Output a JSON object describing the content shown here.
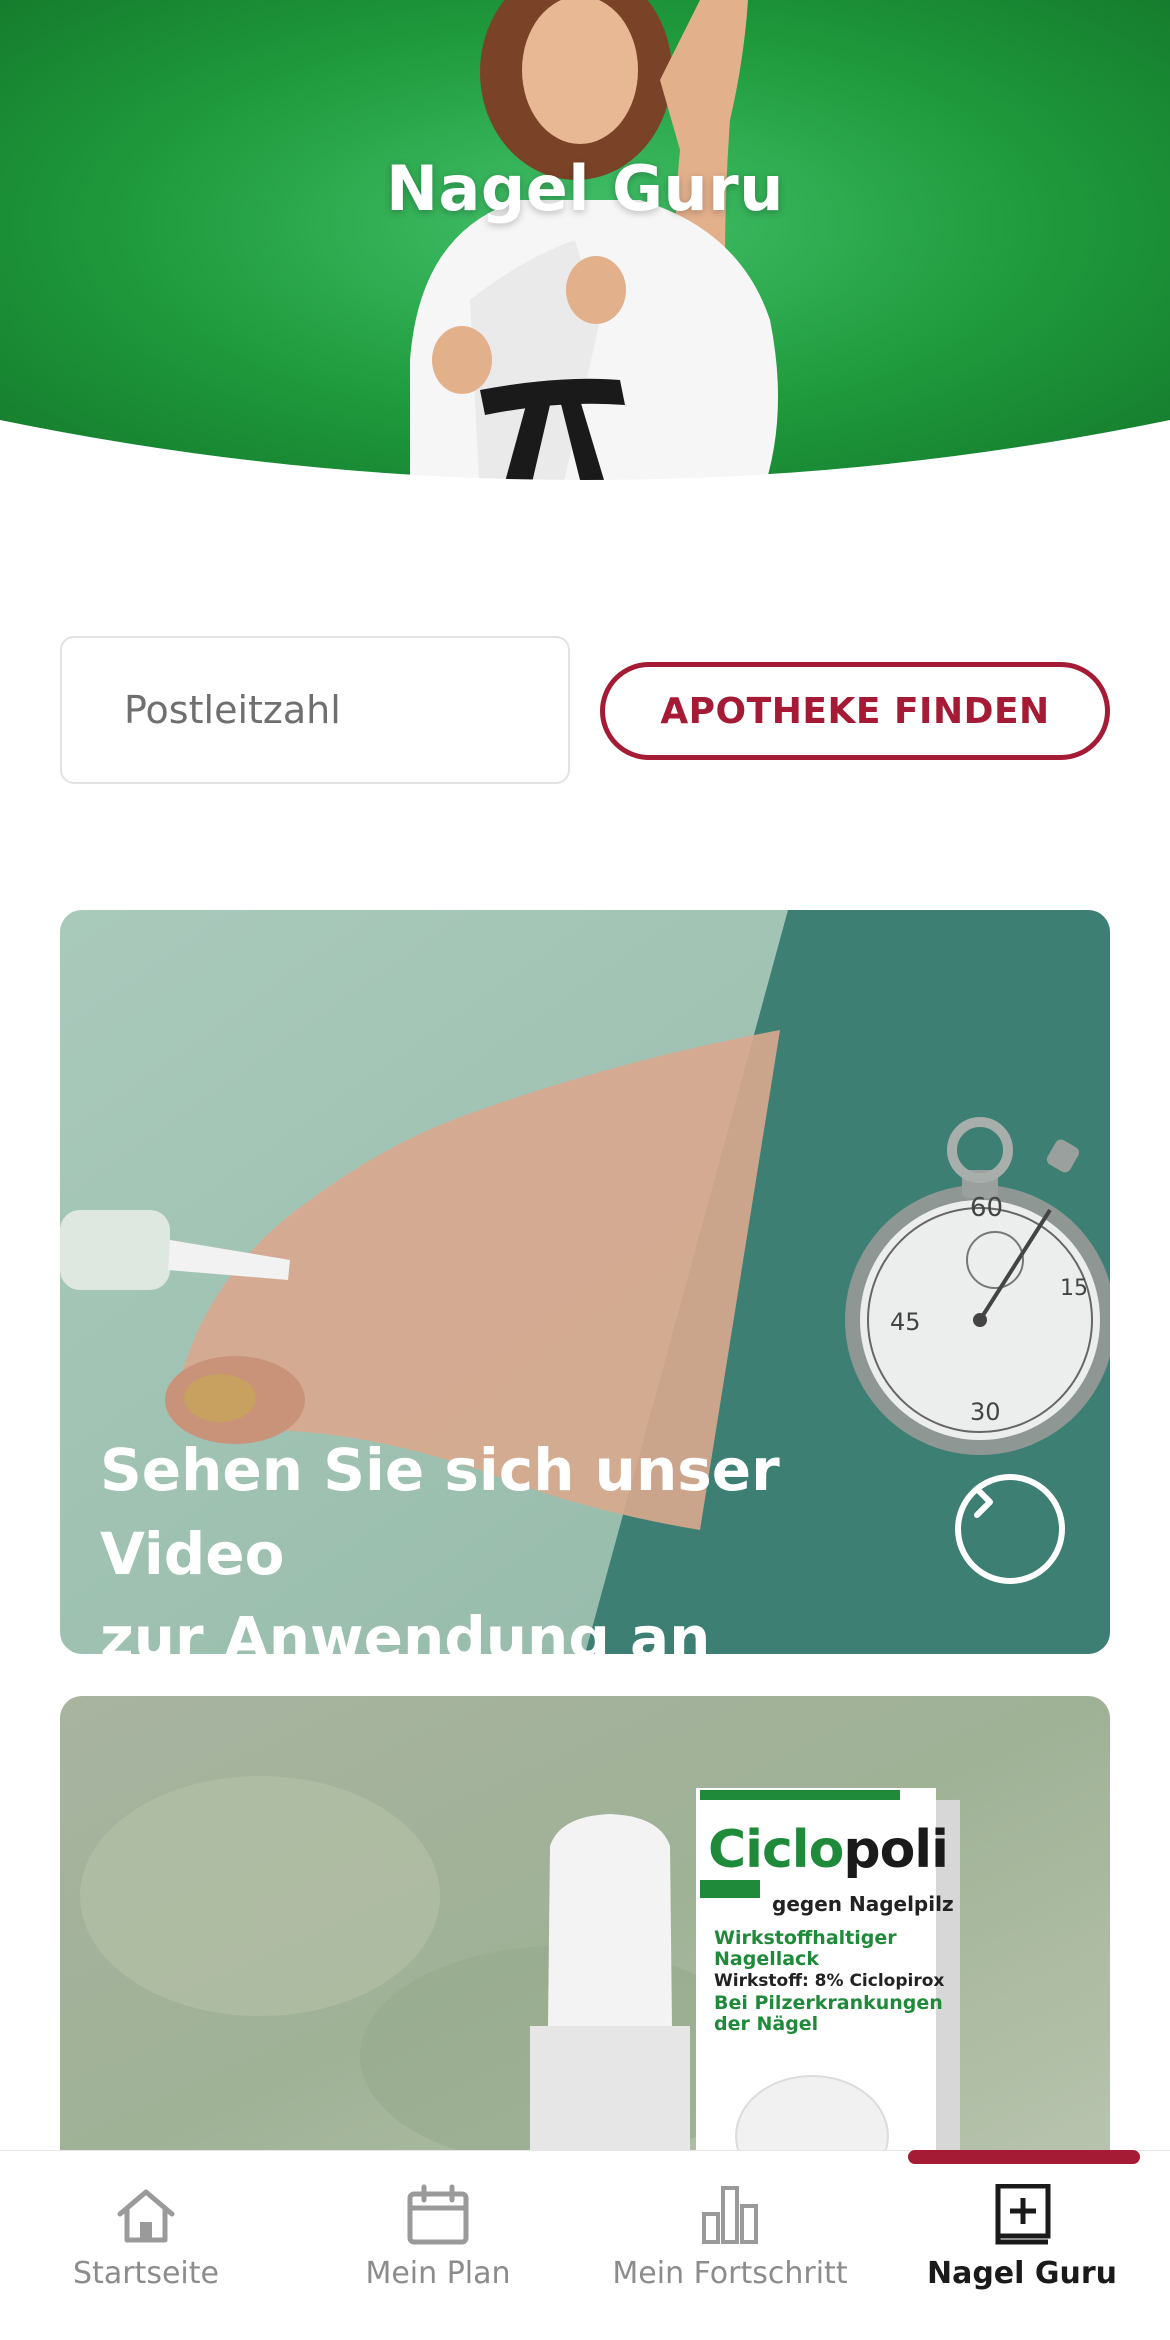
{
  "hero": {
    "title": "Nagel Guru"
  },
  "search": {
    "placeholder": "Postleitzahl",
    "button_label": "APOTHEKE FINDEN"
  },
  "video_card": {
    "line1": "Sehen Sie sich unser Video",
    "line2": "zur Anwendung an"
  },
  "product_card": {
    "brand_part1": "Ciclo",
    "brand_part2": "poli",
    "subtitle": "gegen Nagelpilz",
    "line1": "Wirkstoffhaltiger Nagellack",
    "line2": "Wirkstoff: 8% Ciclopirox",
    "line3": "Bei Pilzerkrankungen der Nägel"
  },
  "nav": {
    "active_tab": "Nagel Guru",
    "items": [
      {
        "label": "Startseite",
        "icon": "home-icon"
      },
      {
        "label": "Mein Plan",
        "icon": "calendar-icon"
      },
      {
        "label": "Mein Fortschritt",
        "icon": "bar-chart-icon"
      },
      {
        "label": "Nagel Guru",
        "icon": "book-plus-icon"
      }
    ]
  },
  "colors": {
    "brand_green": "#1f9a3c",
    "accent_red": "#a51b36",
    "card_teal": "#3e7f74"
  }
}
